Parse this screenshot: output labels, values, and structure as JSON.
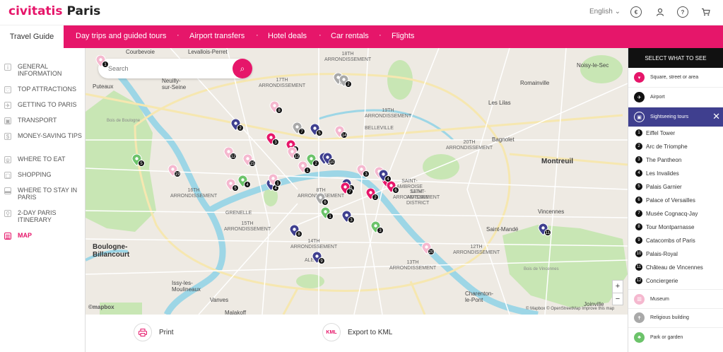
{
  "header": {
    "brand": "civitatis",
    "city": "Paris",
    "language": "English",
    "icons": [
      "currency-euro-icon",
      "user-icon",
      "help-icon",
      "cart-icon"
    ]
  },
  "nav": {
    "guide_label": "Travel Guide",
    "items": [
      {
        "label": "Day trips and guided tours"
      },
      {
        "label": "Airport transfers"
      },
      {
        "label": "Hotel deals"
      },
      {
        "label": "Car rentals"
      },
      {
        "label": "Flights"
      }
    ],
    "accent": "#e6166a"
  },
  "sidebar": {
    "items": [
      {
        "label": "GENERAL INFORMATION",
        "icon": "info-icon"
      },
      {
        "label": "TOP ATTRACTIONS",
        "icon": "heart-icon"
      },
      {
        "label": "GETTING TO PARIS",
        "icon": "plane-icon"
      },
      {
        "label": "TRANSPORT",
        "icon": "bus-icon"
      },
      {
        "label": "MONEY-SAVING TIPS",
        "icon": "money-icon"
      },
      {
        "label": "WHERE TO EAT",
        "icon": "fork-icon"
      },
      {
        "label": "SHOPPING",
        "icon": "bag-icon"
      },
      {
        "label": "WHERE TO STAY IN PARIS",
        "icon": "bed-icon"
      },
      {
        "label": "2-DAY PARIS ITINERARY",
        "icon": "walker-icon"
      },
      {
        "label": "MAP",
        "icon": "map-icon",
        "active": true
      }
    ]
  },
  "map": {
    "search_placeholder": "Search",
    "labels": [
      {
        "text": "Courbevoie"
      },
      {
        "text": "Levallois-Perret"
      },
      {
        "text": "Puteaux"
      },
      {
        "text": "Neuilly-\nsur-Seine"
      },
      {
        "text": "17TH\nARRONDISSEMENT"
      },
      {
        "text": "18TH\nARRONDISSEMENT"
      },
      {
        "text": "Noisy-le-Sec"
      },
      {
        "text": "Romainville"
      },
      {
        "text": "Les Lilas"
      },
      {
        "text": "19TH\nARRONDISSEMENT"
      },
      {
        "text": "Bagnolet"
      },
      {
        "text": "BELLEVILLE"
      },
      {
        "text": "Montreuil"
      },
      {
        "text": "20TH\nARRONDISSEMENT"
      },
      {
        "text": "SAINT-\nAMBROISE"
      },
      {
        "text": "11TH\nARRONDISSEMENT"
      },
      {
        "text": "SAINT-\nANTOINE\nDISTRICT"
      },
      {
        "text": "Vincennes"
      },
      {
        "text": "Saint-Mandé"
      },
      {
        "text": "GRENELLE"
      },
      {
        "text": "15TH\nARRONDISSEMENT"
      },
      {
        "text": "Boulogne-\nBillancourt"
      },
      {
        "text": "14TH\nARRONDISSEMENT"
      },
      {
        "text": "13TH\nARRONDISSEMENT"
      },
      {
        "text": "ALESIA"
      },
      {
        "text": "Issy-les-\nMoulineaux"
      },
      {
        "text": "Vanves"
      },
      {
        "text": "Malakoff"
      },
      {
        "text": "Charenton-\nle-Pont"
      },
      {
        "text": "Joinville"
      },
      {
        "text": "12TH\nARRONDISSEMENT"
      },
      {
        "text": "8TH\nARRONDISSEMENT"
      },
      {
        "text": "16TH\nARRONDISSEMENT"
      },
      {
        "text": "Bois de Vincennes"
      },
      {
        "text": "Bois de Boulogne"
      }
    ],
    "zoom_in": "+",
    "zoom_out": "−",
    "attribution": "© Mapbox  © OpenStreetMap  Improve this map",
    "mapbox_logo": "©mapbox",
    "colors": {
      "land": "#eeeae3",
      "park": "#c8e6b4",
      "water": "#9dd6e6",
      "road": "#ffffff",
      "major_road": "#f6e7b0"
    }
  },
  "markers": {
    "colors": {
      "museum": "#f5b8cf",
      "square": "#e6166a",
      "tour": "#3f3f8f",
      "park": "#6cc36a",
      "religious": "#a9a9a9"
    },
    "pins": [
      {
        "kind": "museum",
        "num": "1"
      },
      {
        "kind": "museum",
        "num": "2"
      },
      {
        "kind": "religious",
        "num": "18"
      },
      {
        "kind": "religious",
        "num": "2"
      },
      {
        "kind": "museum",
        "num": "8"
      },
      {
        "kind": "tour",
        "num": "2"
      },
      {
        "kind": "religious",
        "num": "7"
      },
      {
        "kind": "tour",
        "num": "5"
      },
      {
        "kind": "square",
        "num": "3"
      },
      {
        "kind": "museum",
        "num": "14"
      },
      {
        "kind": "park",
        "num": "5"
      },
      {
        "kind": "museum",
        "num": "19"
      },
      {
        "kind": "museum",
        "num": "12"
      },
      {
        "kind": "museum",
        "num": "15"
      },
      {
        "kind": "tour",
        "num": "1"
      },
      {
        "kind": "park",
        "num": "4"
      },
      {
        "kind": "square",
        "num": "9"
      },
      {
        "kind": "museum",
        "num": "12"
      },
      {
        "kind": "park",
        "num": "2"
      },
      {
        "kind": "tour",
        "num": "10"
      },
      {
        "kind": "museum",
        "num": "1"
      },
      {
        "kind": "museum",
        "num": "3"
      },
      {
        "kind": "museum",
        "num": "3"
      },
      {
        "kind": "tour",
        "num": "4"
      },
      {
        "kind": "museum",
        "num": "5"
      },
      {
        "kind": "square",
        "num": "8"
      },
      {
        "kind": "tour",
        "num": "1"
      },
      {
        "kind": "square",
        "num": "2"
      },
      {
        "kind": "square",
        "num": "7"
      },
      {
        "kind": "religious",
        "num": "6"
      },
      {
        "kind": "park",
        "num": "1"
      },
      {
        "kind": "tour",
        "num": "3"
      },
      {
        "kind": "park",
        "num": "3"
      },
      {
        "kind": "tour",
        "num": "8"
      },
      {
        "kind": "tour",
        "num": "9"
      },
      {
        "kind": "museum",
        "num": "20"
      },
      {
        "kind": "tour",
        "num": "11"
      },
      {
        "kind": "museum",
        "num": "1"
      },
      {
        "kind": "square",
        "num": "6"
      },
      {
        "kind": "tour",
        "num": "4"
      }
    ]
  },
  "bottom": {
    "print_label": "Print",
    "print_icon": "print-icon",
    "kml_badge": "KML",
    "kml_label": "Export to KML"
  },
  "panel": {
    "title": "SELECT WHAT TO SEE",
    "categories_top": [
      {
        "label": "Square, street or area",
        "icon": "square-marker-icon",
        "color": "#e6166a"
      },
      {
        "label": "Airport",
        "icon": "plane-marker-icon",
        "color": "#111111"
      }
    ],
    "selected": {
      "label": "Sightseeing tours",
      "icon": "bus-marker-icon",
      "color": "#3f3f8f"
    },
    "tours": [
      {
        "num": "1",
        "label": "Eiffel Tower"
      },
      {
        "num": "2",
        "label": "Arc de Triomphe"
      },
      {
        "num": "3",
        "label": "The Pantheon"
      },
      {
        "num": "4",
        "label": "Les Invalides"
      },
      {
        "num": "5",
        "label": "Palais Garnier"
      },
      {
        "num": "6",
        "label": "Palace of Versailles"
      },
      {
        "num": "7",
        "label": "Musée Cognacq-Jay"
      },
      {
        "num": "8",
        "label": "Tour Montparnasse"
      },
      {
        "num": "9",
        "label": "Catacombs of Paris"
      },
      {
        "num": "10",
        "label": "Palais-Royal"
      },
      {
        "num": "11",
        "label": "Château de Vincennes"
      },
      {
        "num": "12",
        "label": "Conciergerie"
      }
    ],
    "categories_bottom": [
      {
        "label": "Museum",
        "icon": "museum-marker-icon",
        "color": "#f5b8cf"
      },
      {
        "label": "Religious building",
        "icon": "church-marker-icon",
        "color": "#a9a9a9"
      },
      {
        "label": "Park or garden",
        "icon": "tree-marker-icon",
        "color": "#6cc36a"
      }
    ]
  }
}
